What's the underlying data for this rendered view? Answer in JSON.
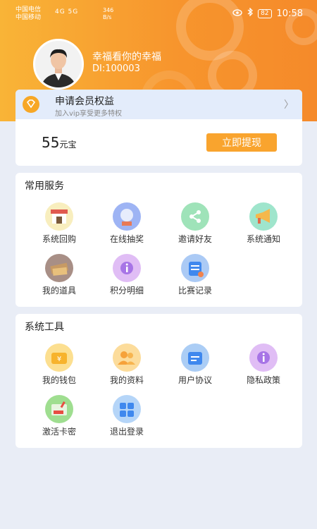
{
  "status_bar": {
    "carrier1": "中国电信",
    "carrier2": "中国移动",
    "signal": "4G 5G",
    "speed_value": "346",
    "speed_unit": "B/s",
    "battery": "82",
    "time": "10:58"
  },
  "profile": {
    "username": "幸福看你的幸福",
    "user_id": "DI:100003"
  },
  "vip": {
    "title": "申请会员权益",
    "subtitle": "加入vip享受更多特权",
    "arrow": "〉"
  },
  "wallet": {
    "amount": "55",
    "unit": "元宝",
    "withdraw_label": "立即提现"
  },
  "common_services": {
    "title": "常用服务",
    "items": [
      {
        "label": "系统回购",
        "icon": "shop-icon",
        "color": "#f6e8a8"
      },
      {
        "label": "在线抽奖",
        "icon": "gift-globe-icon",
        "color": "#7d9bf0"
      },
      {
        "label": "邀请好友",
        "icon": "share-icon",
        "color": "#7fd9a2"
      },
      {
        "label": "系统通知",
        "icon": "megaphone-icon",
        "color": "#7fdcbb"
      },
      {
        "label": "我的道具",
        "icon": "props-icon",
        "color": "#8b6a5d"
      },
      {
        "label": "积分明细",
        "icon": "info-icon",
        "color": "#d6a7f1"
      },
      {
        "label": "比赛记录",
        "icon": "record-icon",
        "color": "#8fb8f2"
      }
    ]
  },
  "system_tools": {
    "title": "系统工具",
    "items": [
      {
        "label": "我的钱包",
        "icon": "wallet-icon",
        "color": "#fbd46b"
      },
      {
        "label": "我的资料",
        "icon": "profile-icon",
        "color": "#fbd07a"
      },
      {
        "label": "用户协议",
        "icon": "agreement-icon",
        "color": "#8fbcf2"
      },
      {
        "label": "隐私政策",
        "icon": "privacy-icon",
        "color": "#d6a7f1"
      },
      {
        "label": "激活卡密",
        "icon": "card-icon",
        "color": "#7fd36b"
      },
      {
        "label": "退出登录",
        "icon": "logout-icon",
        "color": "#9cc7f5"
      }
    ]
  }
}
